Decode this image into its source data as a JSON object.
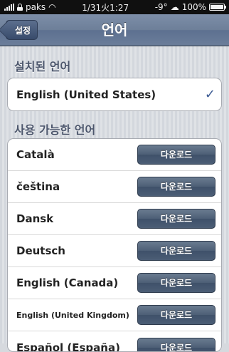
{
  "status_bar": {
    "carrier": "paks",
    "datetime": "1/31火1:27",
    "temperature": "-9°",
    "battery": "100%"
  },
  "nav": {
    "back_label": "설정",
    "title": "언어"
  },
  "installed": {
    "header": "설치된 언어",
    "items": [
      {
        "label": "English (United States)",
        "check": "✓"
      }
    ]
  },
  "available": {
    "header": "사용 가능한 언어",
    "download_label": "다운로드",
    "items": [
      {
        "label": "Català"
      },
      {
        "label": "čeština"
      },
      {
        "label": "Dansk"
      },
      {
        "label": "Deutsch"
      },
      {
        "label": "English (Canada)"
      },
      {
        "label": "English (United Kingdom)"
      },
      {
        "label": "Español (España)"
      }
    ]
  },
  "colors": {
    "nav_bar": "#6d7f99",
    "checkmark": "#3b5a93",
    "download_button": "#4d5f76"
  }
}
